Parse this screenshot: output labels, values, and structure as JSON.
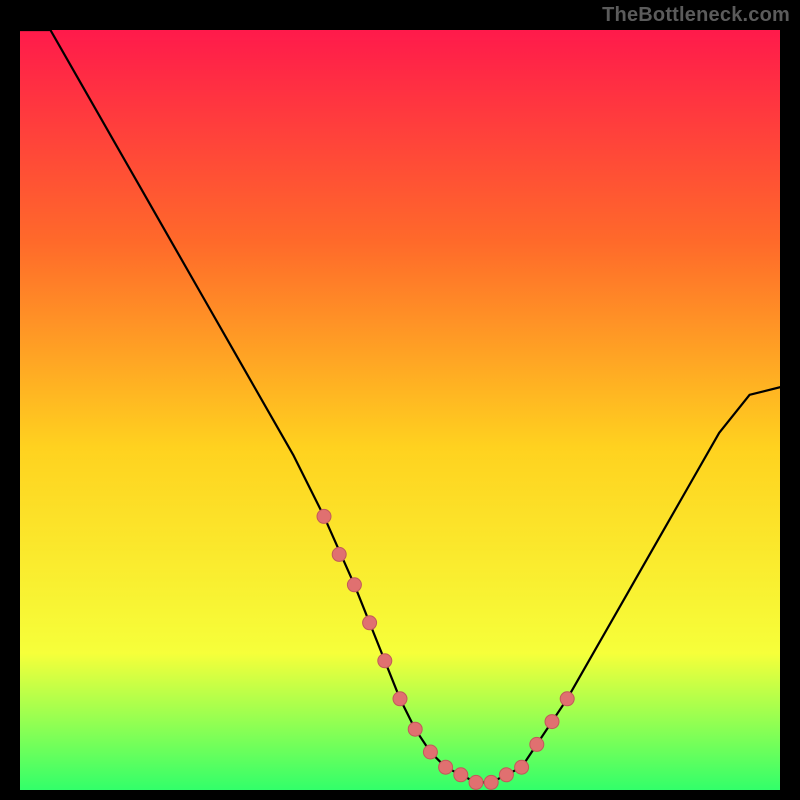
{
  "watermark": "TheBottleneck.com",
  "colors": {
    "background": "#000000",
    "gradient_top": "#ff1a4b",
    "gradient_mid_upper": "#ff6a2a",
    "gradient_mid": "#ffd21f",
    "gradient_lower": "#f6ff3a",
    "gradient_bottom": "#32ff6a",
    "curve": "#000000",
    "marker_fill": "#e07070",
    "marker_stroke": "#c25a5a"
  },
  "chart_data": {
    "type": "line",
    "title": "",
    "xlabel": "",
    "ylabel": "",
    "xlim": [
      0,
      100
    ],
    "ylim": [
      0,
      100
    ],
    "x": [
      0,
      4,
      8,
      12,
      16,
      20,
      24,
      28,
      32,
      36,
      40,
      44,
      48,
      50,
      52,
      54,
      56,
      58,
      60,
      62,
      64,
      66,
      68,
      72,
      76,
      80,
      84,
      88,
      92,
      96,
      100
    ],
    "values": [
      108,
      100,
      93,
      86,
      79,
      72,
      65,
      58,
      51,
      44,
      36,
      27,
      17,
      12,
      8,
      5,
      3,
      2,
      1,
      1,
      2,
      3,
      6,
      12,
      19,
      26,
      33,
      40,
      47,
      52,
      53
    ],
    "markers": {
      "x": [
        40,
        42,
        44,
        46,
        48,
        50,
        52,
        54,
        56,
        58,
        60,
        62,
        64,
        66,
        68,
        70,
        72
      ],
      "values": [
        36,
        31,
        27,
        22,
        17,
        12,
        8,
        5,
        3,
        2,
        1,
        1,
        2,
        3,
        6,
        9,
        12
      ]
    }
  }
}
